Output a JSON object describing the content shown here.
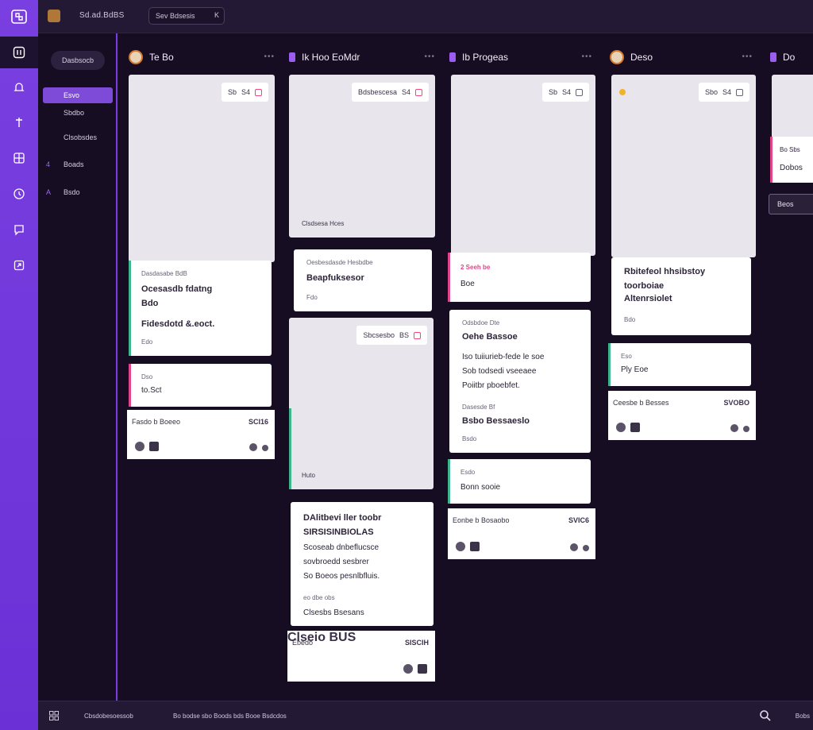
{
  "topbar": {
    "project": "Sd.ad.BdBS",
    "search": "Sev Bdsesis",
    "search_shortcut": "K"
  },
  "sidebar": {
    "pill": "Dasbsocb",
    "items": [
      {
        "label": "Esvo",
        "selected": true
      },
      {
        "label": "Sbdbo"
      },
      {
        "label": "Clsobsdes"
      },
      {
        "label": "Boads",
        "mark": "4"
      },
      {
        "label": "Bsdo",
        "mark": "A"
      }
    ]
  },
  "columns": [
    {
      "title": "Te Bo",
      "head": "avatar"
    },
    {
      "title": "Ik Hoo EoMdr",
      "head": "tag"
    },
    {
      "title": "Ib Progeas",
      "head": "tag"
    },
    {
      "title": "Deso",
      "head": "avatar"
    },
    {
      "title": "Do",
      "head": "tag"
    }
  ],
  "cards": {
    "c1_chip": "Sb",
    "c1_chip_num": "S4",
    "c1b_small": "Dasdasabe BdB",
    "c1b_title1": "Ocesasdb fdatng",
    "c1b_title2": "Bdo",
    "c1b_title3": "Fidesdotd &.eoct.",
    "c1b_meta": "Edo",
    "c1c_small": "Dso",
    "c1c_title": "to.Sct",
    "c1_foot_l": "Fasdo b Boeeo",
    "c1_foot_r": "SCI16",
    "c2_chip": "Bdsbescesa",
    "c2_chip_num": "S4",
    "c2_caption": "Clsdsesa Hces",
    "c2b_small": "Oesbesdasde Hesbdbe",
    "c2b_title": "Beapfuksesor",
    "c2b_meta": "Fdo",
    "c2c_chip": "Sbcsesbo",
    "c2c_chip_num": "BS",
    "c2c_caption": "Huto",
    "c2d_title1": "DAlitbevi ller toobr",
    "c2d_title2": "SIRSISINBIOLAS",
    "c2d_line1": "Scoseab dnbeflucsce",
    "c2d_line2": "sovbroedd sesbrer",
    "c2d_line3": "So Boeos pesnlbfluis.",
    "c2d_meta": "eo dbe obs",
    "c2d_link": "Clsesbs Bsesans",
    "c2_foot_l": "Ebedo",
    "c2_foot_r": "SISCIH",
    "c2_foot_b": "Clseio BUS",
    "c3_chip": "Sb",
    "c3_chip_num": "S4",
    "c3b_small": "2 Seeh be",
    "c3b_title": "Boe",
    "c3c_small": "Odsbdoe Dte",
    "c3c_title1": "Oehe Bassoe",
    "c3c_line1": "Iso tuiiurieb-fede le soe",
    "c3c_line2": "Sob todsedi vseeaee",
    "c3c_line3": "Poiitbr pboebfet.",
    "c3c_meta": "Dasesde Bf",
    "c3c_link": "Bsbo Bessaeslo",
    "c3c_meta2": "Bsdo",
    "c3d_small": "Esdo",
    "c3d_title": "Bonn sooie",
    "c3_foot_l": "Eonbe b Bosaobo",
    "c3_foot_r": "SVIC6",
    "c4_chip": "Sbo",
    "c4_chip_num": "S4",
    "c4b_title1": "Rbitefeol hhsibstoy",
    "c4b_title2": "toorboiae",
    "c4b_title3": "Altenrsiolet",
    "c4b_meta": "Bdo",
    "c4c_small": "Eso",
    "c4c_title": "Ply Eoe",
    "c4_foot_l": "Ceesbe b Besses",
    "c4_foot_r": "SVOBO",
    "c5_small": "Bo Sbs",
    "c5_title": "Dobos",
    "c5_btn": "Beos"
  },
  "bottombar": {
    "left": "Cbsdobesoessob",
    "middle": "Bo bodse sbo Boods bds Booe Bsdcdos",
    "right": "Bobs"
  },
  "colors": {
    "accent": "#7a3fe0",
    "pink": "#e2458a",
    "green": "#3fb58c"
  }
}
